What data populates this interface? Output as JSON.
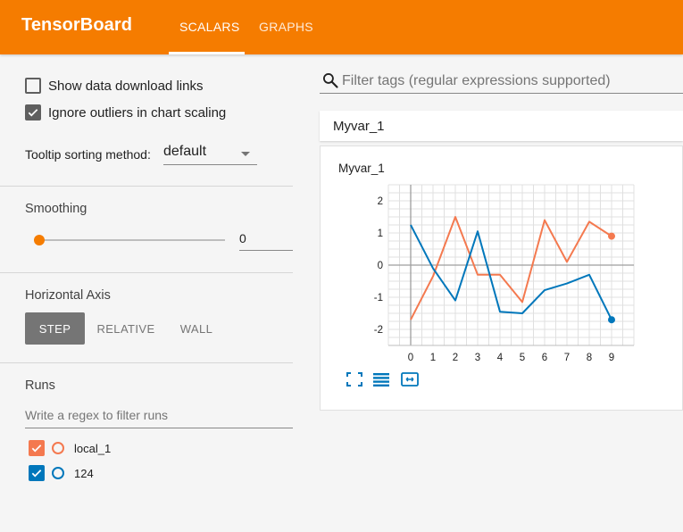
{
  "header": {
    "brand": "TensorBoard",
    "tabs": [
      {
        "label": "SCALARS",
        "active": true
      },
      {
        "label": "GRAPHS",
        "active": false
      }
    ],
    "color": "#f57c00"
  },
  "sidebar": {
    "show_download_links": {
      "label": "Show data download links",
      "checked": false
    },
    "ignore_outliers": {
      "label": "Ignore outliers in chart scaling",
      "checked": true
    },
    "tooltip_sorting": {
      "label": "Tooltip sorting method:",
      "value": "default"
    },
    "smoothing": {
      "label": "Smoothing",
      "value": "0",
      "fraction": 0
    },
    "horizontal_axis": {
      "label": "Horizontal Axis",
      "options": [
        "STEP",
        "RELATIVE",
        "WALL"
      ],
      "selected": "STEP"
    },
    "runs": {
      "label": "Runs",
      "filter_placeholder": "Write a regex to filter runs",
      "items": [
        {
          "name": "local_1",
          "checked": true,
          "color": "#f4794f"
        },
        {
          "name": "124",
          "checked": true,
          "color": "#0077bb"
        }
      ]
    }
  },
  "main": {
    "filter_placeholder": "Filter tags (regular expressions supported)",
    "group_title": "Myvar_1",
    "chart_title": "Myvar_1",
    "icons": [
      "fullscreen-icon",
      "log-scale-icon",
      "fit-domain-icon"
    ]
  },
  "chart_data": {
    "type": "line",
    "title": "Myvar_1",
    "x": [
      0,
      1,
      2,
      3,
      4,
      5,
      6,
      7,
      8,
      9
    ],
    "xlim": [
      -1,
      10
    ],
    "ylim": [
      -2.5,
      2.5
    ],
    "xticks": [
      "0",
      "1",
      "2",
      "3",
      "4",
      "5",
      "6",
      "7",
      "8",
      "9"
    ],
    "yticks": [
      "2",
      "1",
      "0",
      "-1",
      "-2"
    ],
    "yticks_values": [
      2,
      1,
      0,
      -1,
      -2
    ],
    "grid": true,
    "series": [
      {
        "name": "local_1",
        "color": "#f4794f",
        "values": [
          -1.7,
          -0.35,
          1.5,
          -0.3,
          -0.3,
          -1.15,
          1.4,
          0.1,
          1.35,
          0.9
        ]
      },
      {
        "name": "124",
        "color": "#0077bb",
        "values": [
          1.25,
          -0.1,
          -1.1,
          1.05,
          -1.45,
          -1.5,
          -0.78,
          -0.57,
          -0.3,
          -1.7
        ]
      }
    ]
  }
}
